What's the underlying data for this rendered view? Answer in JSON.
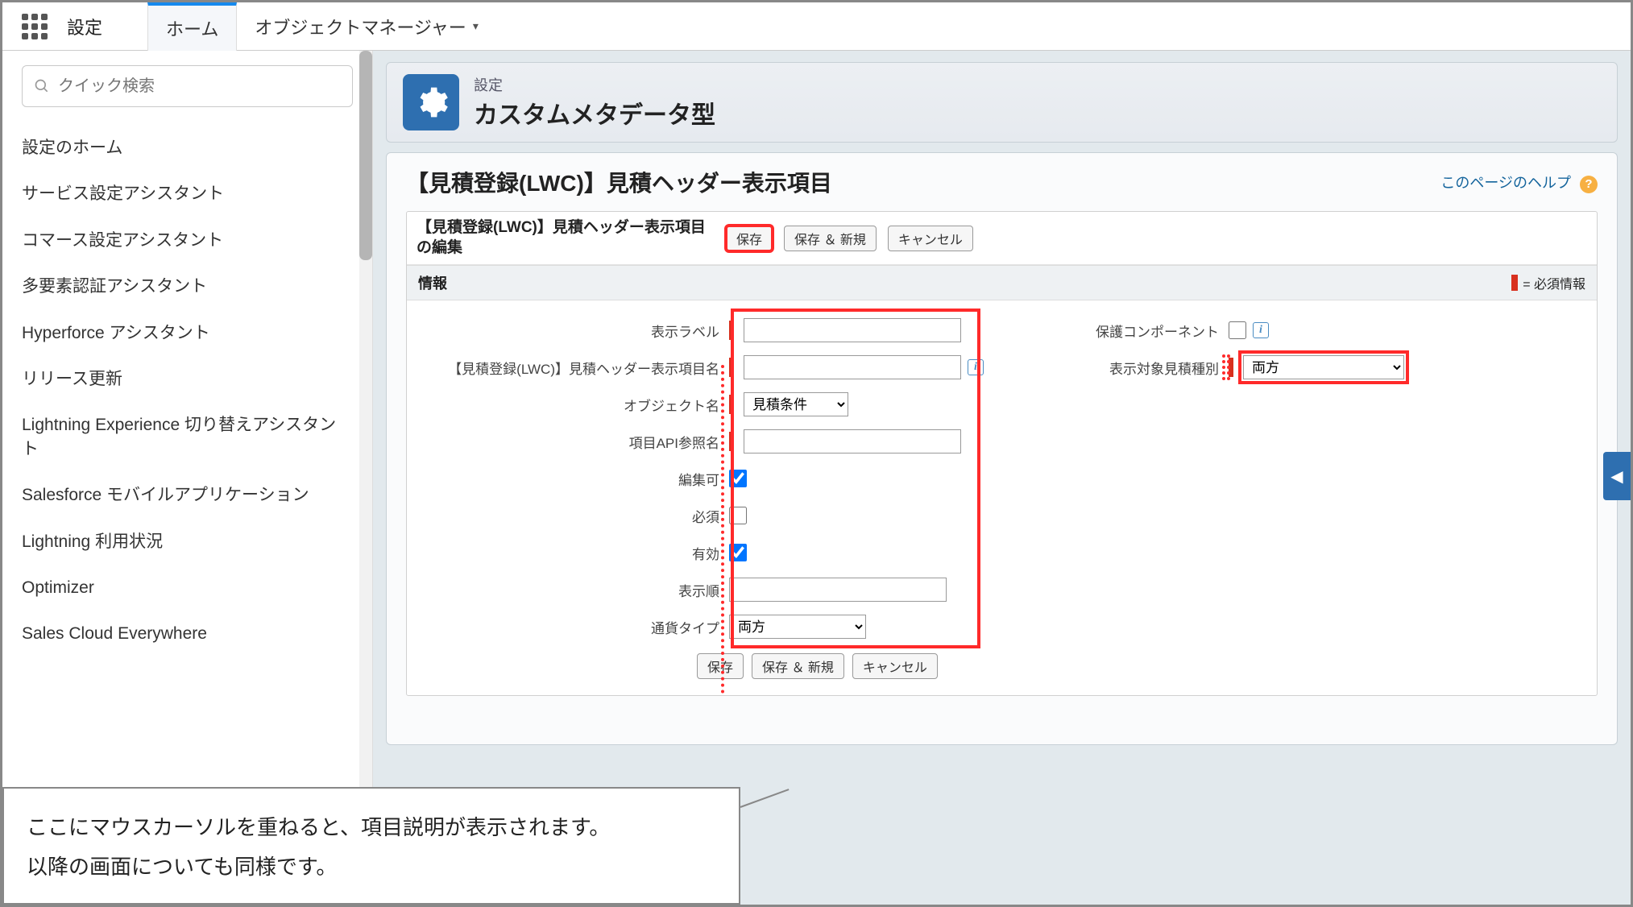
{
  "top": {
    "setup": "設定",
    "tab_home": "ホーム",
    "tab_obj_mgr": "オブジェクトマネージャー"
  },
  "sidebar": {
    "search_placeholder": "クイック検索",
    "items": [
      "設定のホーム",
      "サービス設定アシスタント",
      "コマース設定アシスタント",
      "多要素認証アシスタント",
      "Hyperforce アシスタント",
      "リリース更新",
      "Lightning Experience 切り替えアシスタント",
      "Salesforce モバイルアプリケーション",
      "Lightning 利用状況",
      "Optimizer",
      "Sales Cloud Everywhere"
    ]
  },
  "header": {
    "small": "設定",
    "big": "カスタムメタデータ型"
  },
  "detail": {
    "title": "【見積登録(LWC)】見積ヘッダー表示項目",
    "help_link": "このページのヘルプ"
  },
  "edit": {
    "header_title": "【見積登録(LWC)】見積ヘッダー表示項目の編集",
    "btn_save": "保存",
    "btn_save_new": "保存 ＆ 新規",
    "btn_cancel": "キャンセル"
  },
  "section": {
    "label": "情報",
    "req_legend": "= 必須情報"
  },
  "fields": {
    "label_display_label": "表示ラベル",
    "label_name": "【見積登録(LWC)】見積ヘッダー表示項目名",
    "label_object": "オブジェクト名",
    "label_api": "項目API参照名",
    "label_editable": "編集可",
    "label_required": "必須",
    "label_enabled": "有効",
    "label_order": "表示順",
    "label_currency_type": "通貨タイプ",
    "label_protected": "保護コンポーネント",
    "label_target_quote_type": "表示対象見積種別",
    "value_display_label": "",
    "value_name": "",
    "object_options": [
      "見積条件"
    ],
    "value_object": "見積条件",
    "value_api": "",
    "value_editable": true,
    "value_required": false,
    "value_enabled": true,
    "value_order": "",
    "currency_options": [
      "両方"
    ],
    "value_currency_type": "両方",
    "value_protected": false,
    "target_type_options": [
      "両方"
    ],
    "value_target_type": "両方"
  },
  "callout": {
    "line1": "ここにマウスカーソルを重ねると、項目説明が表示されます。",
    "line2": "以降の画面についても同様です。"
  }
}
